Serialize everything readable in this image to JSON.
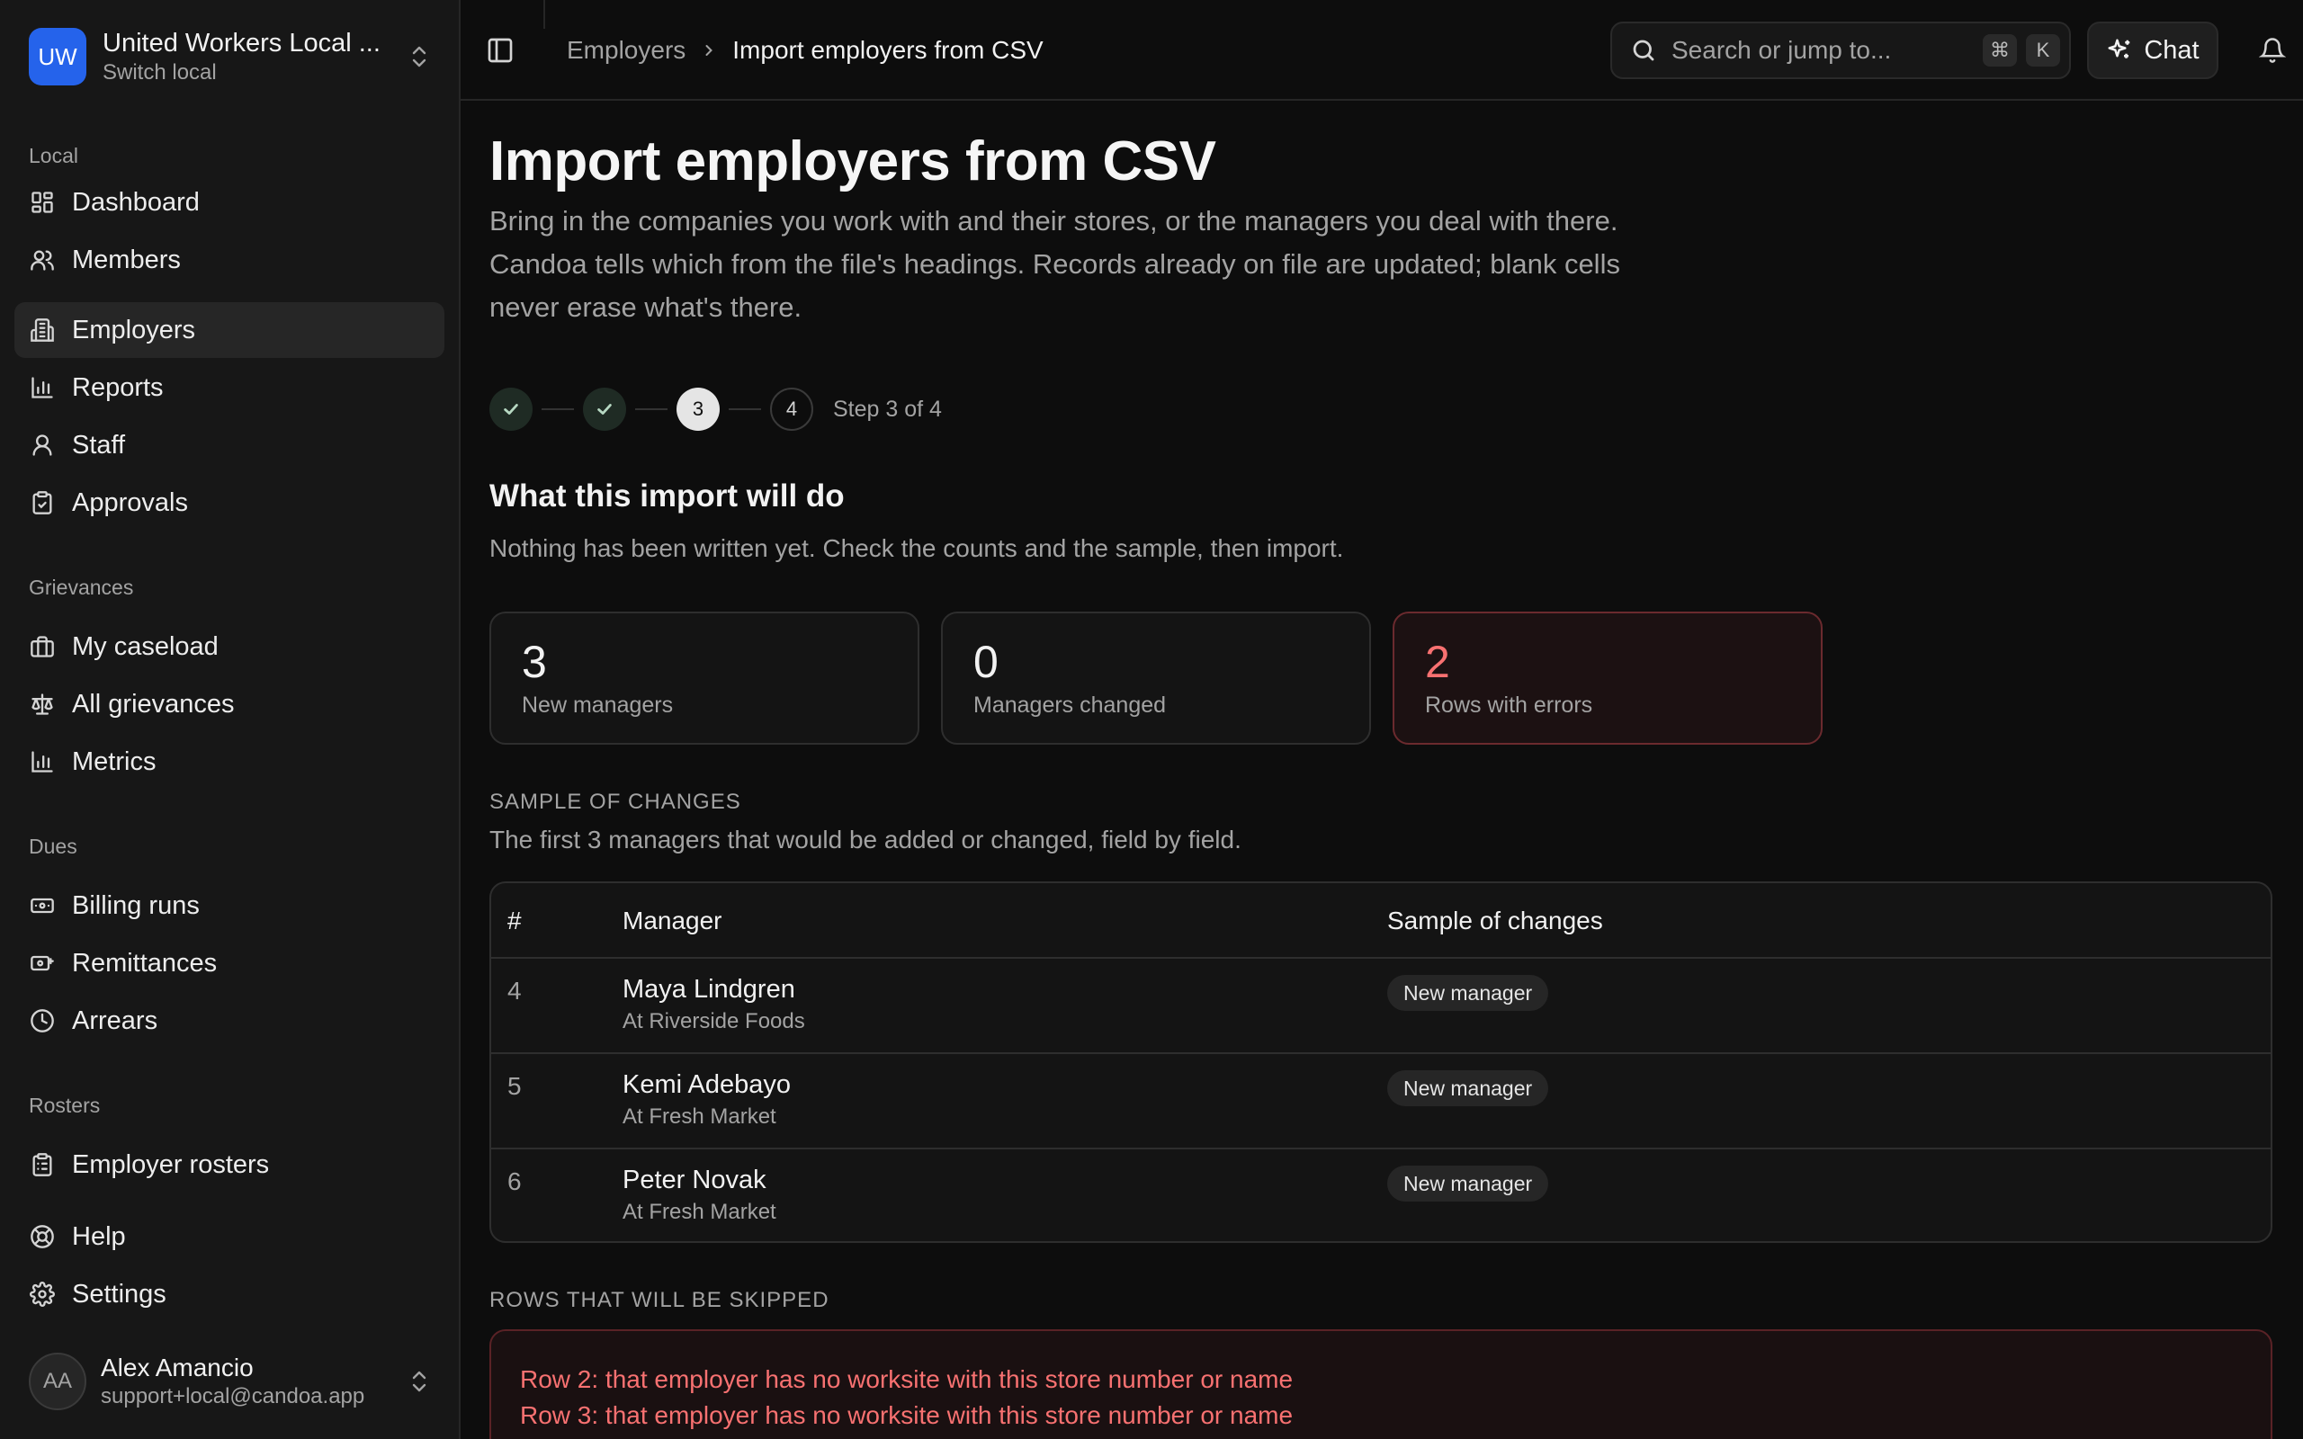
{
  "org": {
    "initials": "UW",
    "name": "United Workers Local ...",
    "sub": "Switch local"
  },
  "nav": {
    "local_title": "Local",
    "local": [
      {
        "label": "Dashboard",
        "icon": "dashboard-icon"
      },
      {
        "label": "Members",
        "icon": "users-icon"
      },
      {
        "label": "Employers",
        "icon": "building-icon",
        "active": true
      },
      {
        "label": "Reports",
        "icon": "bar-chart-icon"
      },
      {
        "label": "Staff",
        "icon": "user-icon"
      },
      {
        "label": "Approvals",
        "icon": "clipboard-check-icon"
      }
    ],
    "grievances_title": "Grievances",
    "grievances": [
      {
        "label": "My caseload",
        "icon": "briefcase-icon"
      },
      {
        "label": "All grievances",
        "icon": "scale-icon"
      },
      {
        "label": "Metrics",
        "icon": "bar-chart-icon"
      }
    ],
    "dues_title": "Dues",
    "dues": [
      {
        "label": "Billing runs",
        "icon": "banknote-icon"
      },
      {
        "label": "Remittances",
        "icon": "remittance-icon"
      },
      {
        "label": "Arrears",
        "icon": "clock-icon"
      }
    ],
    "rosters_title": "Rosters",
    "rosters": [
      {
        "label": "Employer rosters",
        "icon": "clipboard-list-icon"
      }
    ],
    "help": "Help",
    "settings": "Settings"
  },
  "user": {
    "initials": "AA",
    "name": "Alex Amancio",
    "email": "support+local@candoa.app"
  },
  "topbar": {
    "breadcrumb_parent": "Employers",
    "breadcrumb_current": "Import employers from CSV",
    "search_placeholder": "Search or jump to...",
    "kbd_cmd": "⌘",
    "kbd_k": "K",
    "chat_label": "Chat"
  },
  "page": {
    "title": "Import employers from CSV",
    "description": "Bring in the companies you work with and their stores, or the managers you deal with there. Candoa tells which from the file's headings. Records already on file are updated; blank cells never erase what's there."
  },
  "stepper": {
    "steps": [
      "1",
      "2",
      "3",
      "4"
    ],
    "current_step": 3,
    "label": "Step 3 of 4"
  },
  "summary": {
    "title": "What this import will do",
    "subtitle": "Nothing has been written yet. Check the counts and the sample, then import.",
    "stats": [
      {
        "value": "3",
        "label": "New managers"
      },
      {
        "value": "0",
        "label": "Managers changed"
      },
      {
        "value": "2",
        "label": "Rows with errors"
      }
    ]
  },
  "sample": {
    "heading": "SAMPLE OF CHANGES",
    "subtitle": "The first 3 managers that would be added or changed, field by field.",
    "columns": [
      "#",
      "Manager",
      "Sample of changes"
    ],
    "rows": [
      {
        "num": "4",
        "name": "Maya Lindgren",
        "at": "At Riverside Foods",
        "change": "New manager"
      },
      {
        "num": "5",
        "name": "Kemi Adebayo",
        "at": "At Fresh Market",
        "change": "New manager"
      },
      {
        "num": "6",
        "name": "Peter Novak",
        "at": "At Fresh Market",
        "change": "New manager"
      }
    ]
  },
  "skipped": {
    "heading": "ROWS THAT WILL BE SKIPPED",
    "errors": [
      "Row 2: that employer has no worksite with this store number or name",
      "Row 3: that employer has no worksite with this store number or name"
    ]
  },
  "colors": {
    "accent": "#2563eb",
    "error": "#f87171",
    "background": "#0d0d0d",
    "sidebar": "#171717"
  }
}
